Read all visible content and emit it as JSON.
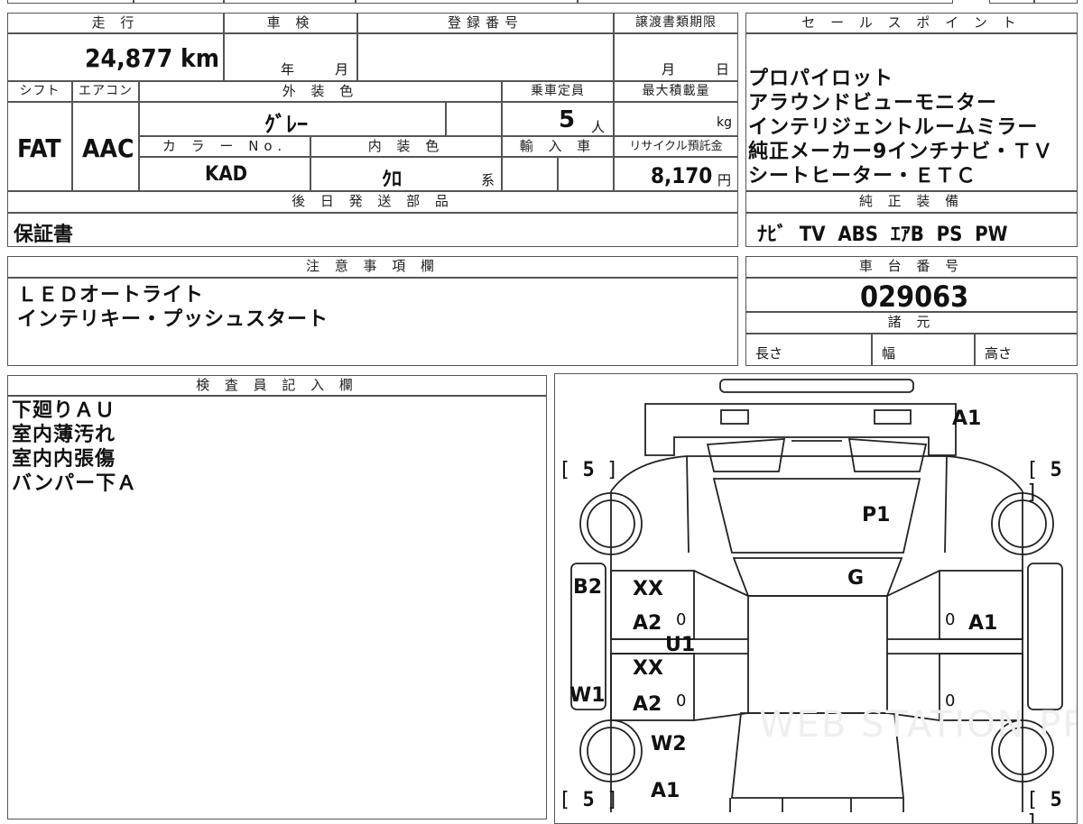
{
  "headers": {
    "mileage": "走 行",
    "inspection": "車 検",
    "registration": "登録番号",
    "transfer_deadline": "譲渡書類期限",
    "shift": "シフト",
    "aircon": "エアコン",
    "exterior_color": "外 装 色",
    "capacity": "乗車定員",
    "max_load": "最大積載量",
    "color_no": "カ ラ ー No.",
    "interior_color": "内 装 色",
    "import": "輸 入 車",
    "recycle": "リサイクル預託金",
    "later_parts": "後 日 発 送 部 品",
    "sales_point": "セ ー ル ス ポ イ ン ト",
    "standard_equipment": "純 正 装 備",
    "notes": "注 意 事 項 欄",
    "chassis_no": "車 台 番 号",
    "specs": "諸 元",
    "inspector": "検 査 員 記 入 欄"
  },
  "values": {
    "mileage": "24,877 km",
    "year_unit": "年",
    "month_unit": "月",
    "transfer_month": "月",
    "transfer_day": "日",
    "shift": "FAT",
    "aircon": "AAC",
    "exterior_color": "ｸﾞﾚｰ",
    "capacity": "5",
    "capacity_unit": "人",
    "max_load_unit": "kg",
    "color_no": "KAD",
    "interior_color": "ｸﾛ",
    "interior_suffix": "系",
    "recycle_amount": "8,170",
    "recycle_unit": "円",
    "later_parts": "保証書",
    "standard_equipment": "ﾅﾋﾞ  TV  ABS  ｴｱB  PS  PW",
    "chassis_no": "029063",
    "length_label": "長さ",
    "width_label": "幅",
    "height_label": "高さ"
  },
  "sales_points": [
    "プロパイロット",
    "アラウンドビューモニター",
    "インテリジェントルームミラー",
    "純正メーカー9インチナビ・ＴＶ",
    "シートヒーター・ＥＴＣ"
  ],
  "notes": [
    "ＬＥＤオートライト",
    "インテリキー・プッシュスタート"
  ],
  "inspector_notes": [
    "下廻りＡＵ",
    "室内薄汚れ",
    "室内内張傷",
    "バンパー下Ａ"
  ],
  "diagram": {
    "front_bumper": "A1",
    "hood": "P1",
    "windshield": "G",
    "left_fender": "B2",
    "left_front_door_1": "XX",
    "left_front_door_2": "A2",
    "left_center": "U1",
    "left_rear_door_1": "XX",
    "left_rear_door_2": "A2",
    "left_sill": "W1",
    "left_rear_fender": "W2",
    "rear_bumper": "A1",
    "right_front_door": "A1",
    "zero_marks": [
      "0",
      "0",
      "0",
      "0"
    ],
    "tire_marks": [
      "5",
      "5",
      "5",
      "5"
    ],
    "watermark": "WEB STATION PRO"
  }
}
